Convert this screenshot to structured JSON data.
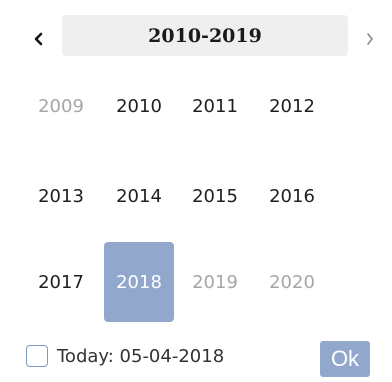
{
  "header": {
    "prev_icon": "chevron-left-icon",
    "next_icon": "chevron-right-icon",
    "title": "2010-2019"
  },
  "years": [
    {
      "label": "2009",
      "state": "outside-decade"
    },
    {
      "label": "2010",
      "state": "normal"
    },
    {
      "label": "2011",
      "state": "normal"
    },
    {
      "label": "2012",
      "state": "normal"
    },
    {
      "label": "2013",
      "state": "normal"
    },
    {
      "label": "2014",
      "state": "normal"
    },
    {
      "label": "2015",
      "state": "normal"
    },
    {
      "label": "2016",
      "state": "normal"
    },
    {
      "label": "2017",
      "state": "normal"
    },
    {
      "label": "2018",
      "state": "selected"
    },
    {
      "label": "2019",
      "state": "disabled"
    },
    {
      "label": "2020",
      "state": "outside-decade"
    }
  ],
  "footer": {
    "today_checked": false,
    "today_label": "Today: 05-04-2018",
    "ok_label": "Ok"
  },
  "colors": {
    "accent": "#91a8cc",
    "muted_text": "#a6a6a6",
    "title_bg": "#efefef"
  }
}
